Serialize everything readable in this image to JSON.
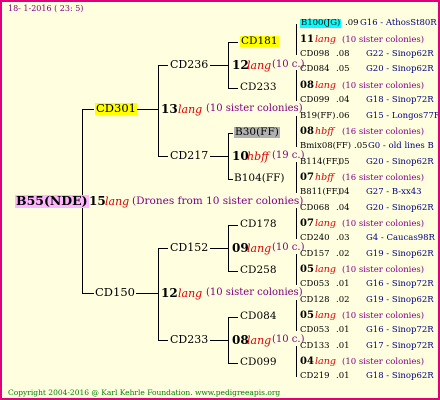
{
  "header": {
    "date": "18- 1-2016 ( 23: 5)"
  },
  "footer": {
    "copyright": "Copyright 2004-2016 @ Karl Kehrle Foundation.   www.pedigreeapis.org"
  },
  "colors": {
    "frame": "#e0007a",
    "background": "#ffffe0",
    "highlight_yellow": "#ffff00",
    "highlight_cyan": "#00ffff",
    "highlight_gray": "#b0b0b0",
    "strain_red": "#e00000",
    "sister_purple": "#800080",
    "drone_navy": "#000080"
  },
  "gen0": {
    "queen": "B55(NDE)",
    "year": "15",
    "strain": "lang",
    "note": "(Drones from 10 sister colonies)"
  },
  "gen1": [
    {
      "queen": "CD301",
      "year": "13",
      "strain": "lang",
      "note": "(10 sister colonies)"
    },
    {
      "queen": "CD150",
      "year": "12",
      "strain": "lang",
      "note": "(10 sister colonies)"
    }
  ],
  "gen2": [
    {
      "queen": "CD236",
      "year": "12",
      "strain": "lang",
      "note": "(10 c.)"
    },
    {
      "queen": "CD217",
      "year": "10",
      "strain": "hbff",
      "note": "(19 c.)"
    },
    {
      "queen": "CD152",
      "year": "09",
      "strain": "lang",
      "note": "(10 c.)"
    },
    {
      "queen": "CD233",
      "year": "08",
      "strain": "lang",
      "note": "(10 c.)"
    }
  ],
  "gen3": [
    {
      "queen": "CD181",
      "year": "11",
      "strain": "lang",
      "note": "(10 sister colonies)"
    },
    {
      "queen": "CD233",
      "year": "08",
      "strain": "lang",
      "note": "(10 sister colonies)"
    },
    {
      "queen": "B30(FF)",
      "year": "08",
      "strain": "hbff",
      "note": "(16 sister colonies)"
    },
    {
      "queen": "B104(FF)",
      "year": "07",
      "strain": "hbff",
      "note": "(16 sister colonies)"
    },
    {
      "queen": "CD178",
      "year": "07",
      "strain": "lang",
      "note": "(10 sister colonies)"
    },
    {
      "queen": "CD258",
      "year": "05",
      "strain": "lang",
      "note": "(10 sister colonies)"
    },
    {
      "queen": "CD084",
      "year": "05",
      "strain": "lang",
      "note": "(10 sister colonies)"
    },
    {
      "queen": "CD099",
      "year": "04",
      "strain": "lang",
      "note": "(10 sister colonies)"
    }
  ],
  "gen4": [
    {
      "queen": "B100(JG)",
      "year": ".09",
      "drone": "G16 - AthosSt80R"
    },
    {
      "queen": "CD098",
      "year": ".08",
      "drone": "G22 - Sinop62R"
    },
    {
      "queen": "CD084",
      "year": ".05",
      "drone": "G20 - Sinop62R"
    },
    {
      "queen": "CD099",
      "year": ".04",
      "drone": "G18 - Sinop72R"
    },
    {
      "queen": "B19(FF)",
      "year": ".06",
      "drone": "G15 - Longos77R"
    },
    {
      "queen": "Bmix08(FF)",
      "year": ".05",
      "drone": "G0 - old lines B"
    },
    {
      "queen": "B114(FF)",
      "year": ".05",
      "drone": "G20 - Sinop62R"
    },
    {
      "queen": "B811(FF)",
      "year": ".04",
      "drone": "G27 - B-xx43"
    },
    {
      "queen": "CD068",
      "year": ".04",
      "drone": "G20 - Sinop62R"
    },
    {
      "queen": "CD240",
      "year": ".03",
      "drone": "G4 - Caucas98R"
    },
    {
      "queen": "CD157",
      "year": ".02",
      "drone": "G19 - Sinop62R"
    },
    {
      "queen": "CD053",
      "year": ".01",
      "drone": "G16 - Sinop72R"
    },
    {
      "queen": "CD128",
      "year": ".02",
      "drone": "G19 - Sinop62R"
    },
    {
      "queen": "CD053",
      "year": ".01",
      "drone": "G16 - Sinop72R"
    },
    {
      "queen": "CD133",
      "year": ".01",
      "drone": "G17 - Sinop72R"
    },
    {
      "queen": "CD219",
      "year": ".01",
      "drone": "G18 - Sinop62R"
    }
  ]
}
